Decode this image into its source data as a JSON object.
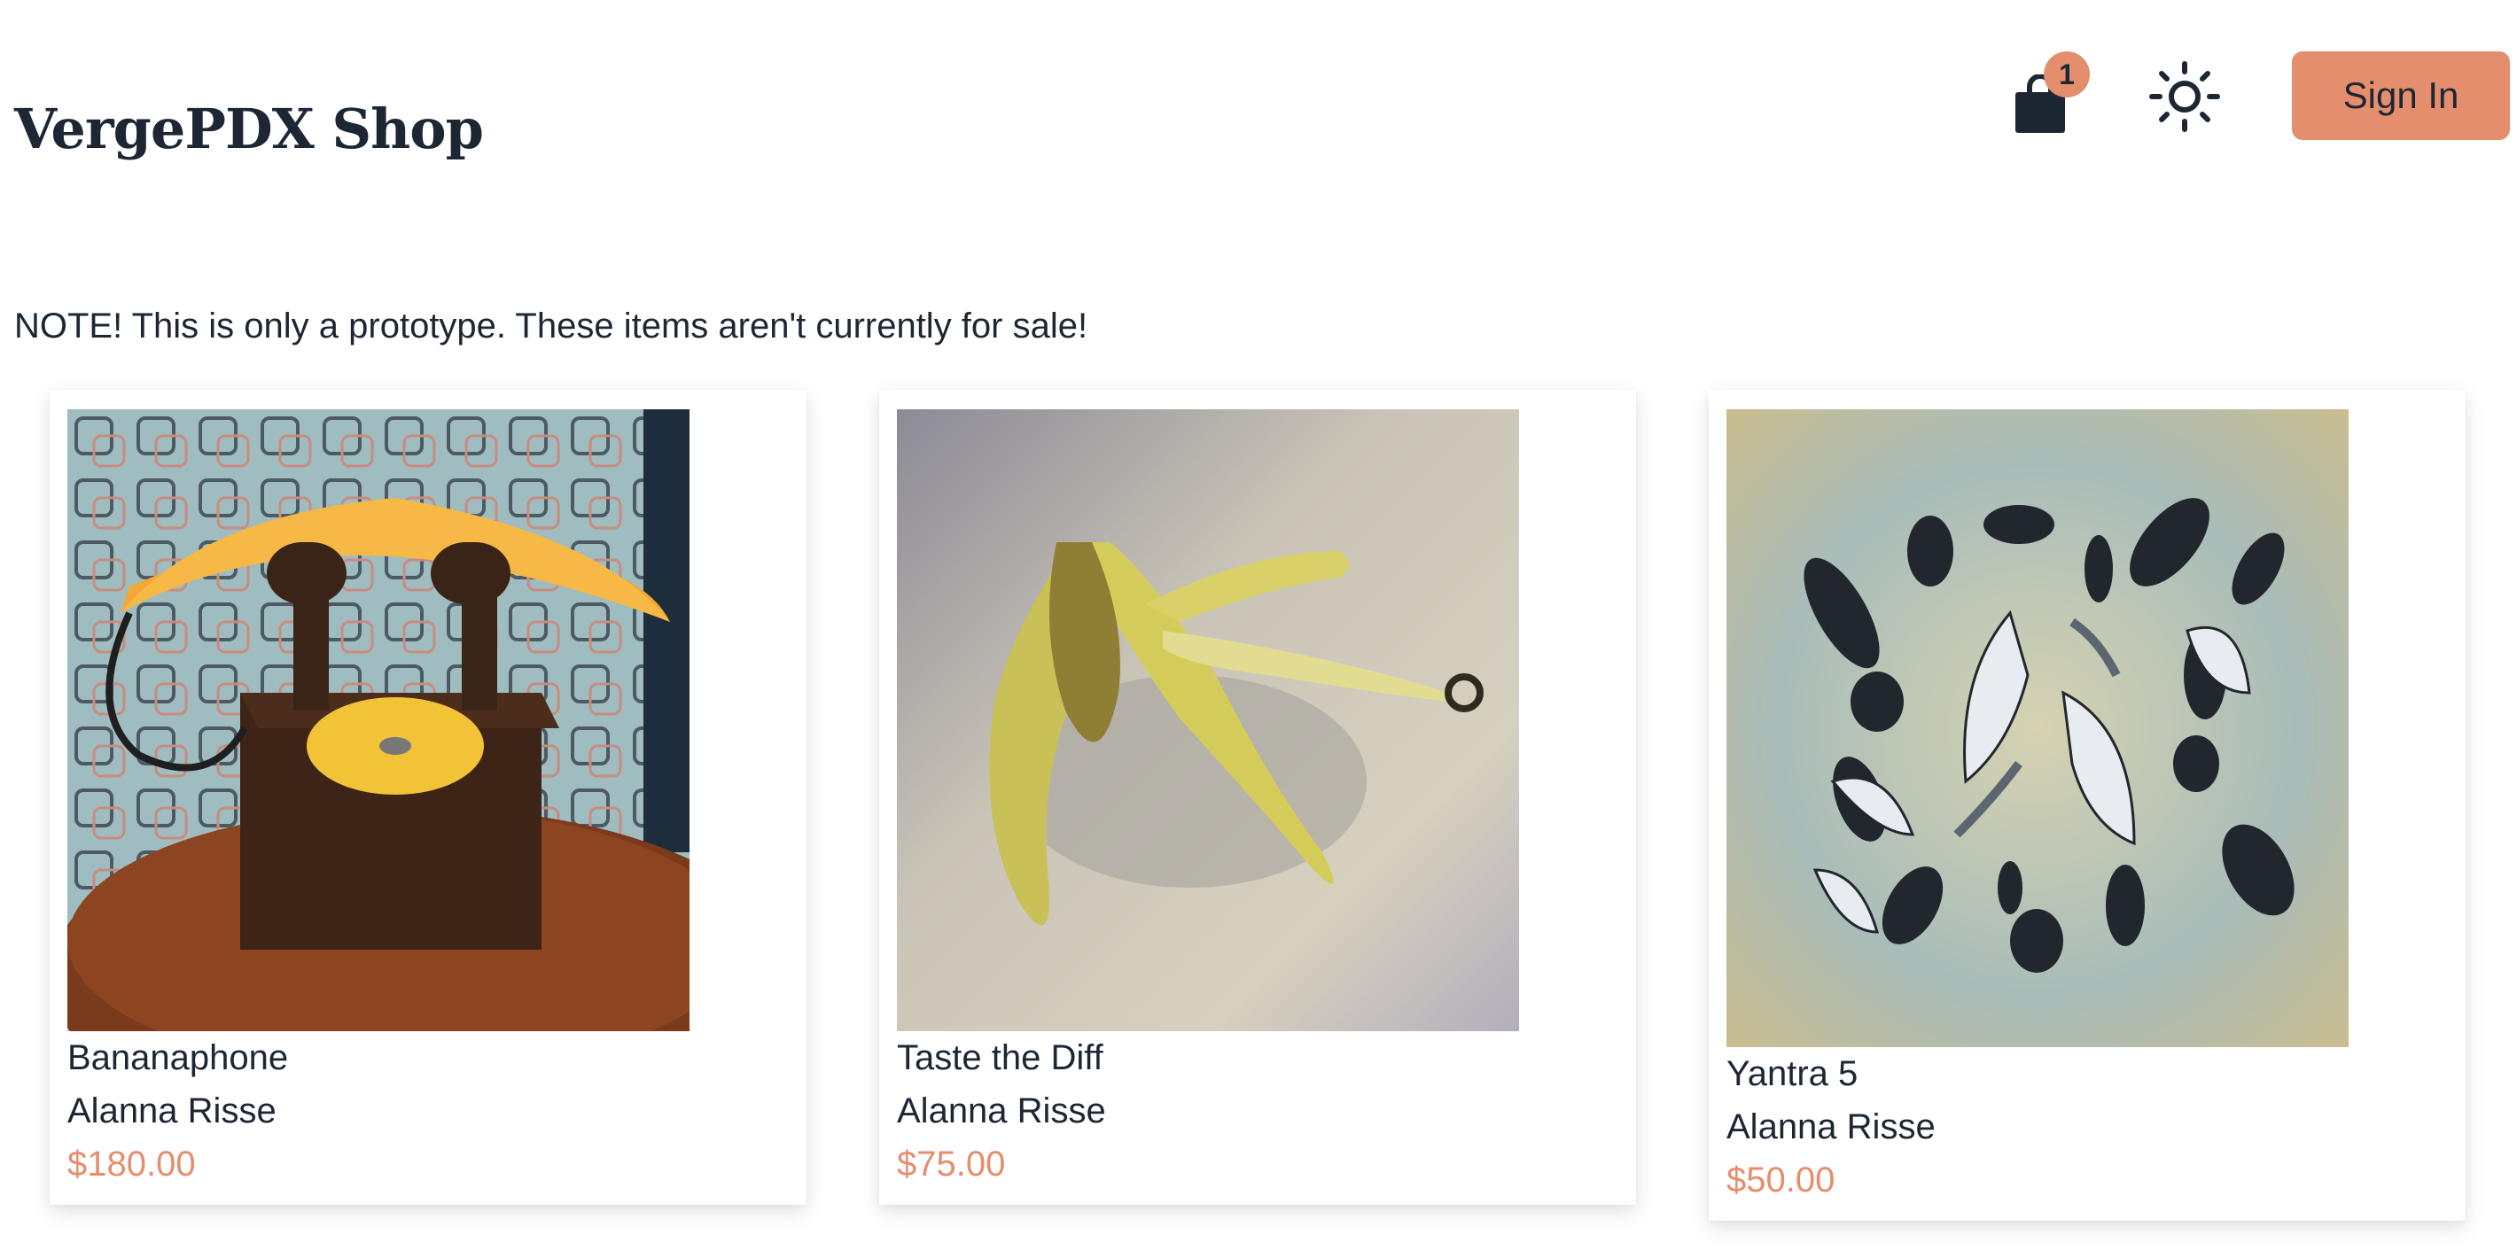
{
  "header": {
    "title": "VergePDX Shop",
    "cart_count": "1",
    "cart_icon": "shopping-bag-icon",
    "theme_icon": "sun-icon",
    "sign_in_label": "Sign In"
  },
  "notice": "NOTE! This is only a prototype. These items aren't currently for sale!",
  "colors": {
    "accent": "#e58e6d",
    "text": "#1d2733",
    "background": "#ffffff"
  },
  "products": [
    {
      "title": "Bananaphone",
      "artist": "Alanna Risse",
      "price": "$180.00"
    },
    {
      "title": "Taste the Diff",
      "artist": "Alanna Risse",
      "price": "$75.00"
    },
    {
      "title": "Yantra 5",
      "artist": "Alanna Risse",
      "price": "$50.00"
    }
  ]
}
